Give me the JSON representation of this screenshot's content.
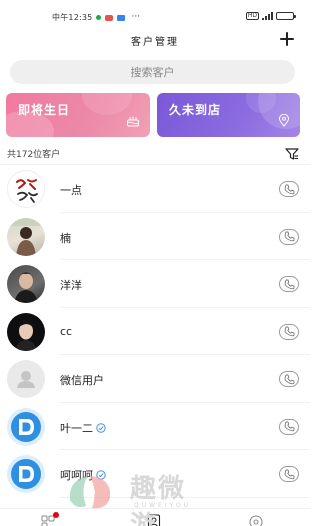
{
  "status_bar": {
    "time": "中午12:35",
    "more": "···",
    "network": "HD",
    "battery_level": 0.9
  },
  "header": {
    "title": "客户管理",
    "add_icon": "plus-icon"
  },
  "search": {
    "placeholder": "搜索客户"
  },
  "cards": {
    "birthday": {
      "label": "即将生日",
      "icon": "cake-icon",
      "color": "#f07aa0"
    },
    "absent": {
      "label": "久未到店",
      "icon": "location-pin-icon",
      "color": "#7a58d8"
    }
  },
  "summary": {
    "count_text": "共172位客户",
    "filter_icon": "filter-icon"
  },
  "customers": [
    {
      "name": "一点",
      "avatar": "calligraphy-avatar",
      "verified": false
    },
    {
      "name": "楠",
      "avatar": "photo-avatar",
      "verified": false
    },
    {
      "name": "洋洋",
      "avatar": "photo-avatar",
      "verified": false
    },
    {
      "name": "cc",
      "avatar": "photo-avatar",
      "verified": false
    },
    {
      "name": "微信用户",
      "avatar": "default-user-avatar",
      "verified": false
    },
    {
      "name": "叶一二",
      "avatar": "logo-avatar",
      "verified": true
    },
    {
      "name": "呵呵呵",
      "avatar": "logo-avatar",
      "verified": true
    }
  ],
  "bottom_nav": {
    "items": [
      "grid-nav-icon",
      "contacts-nav-icon",
      "profile-nav-icon"
    ]
  },
  "watermark": {
    "text": "趣微游",
    "sub": "QUWEIYOU"
  }
}
